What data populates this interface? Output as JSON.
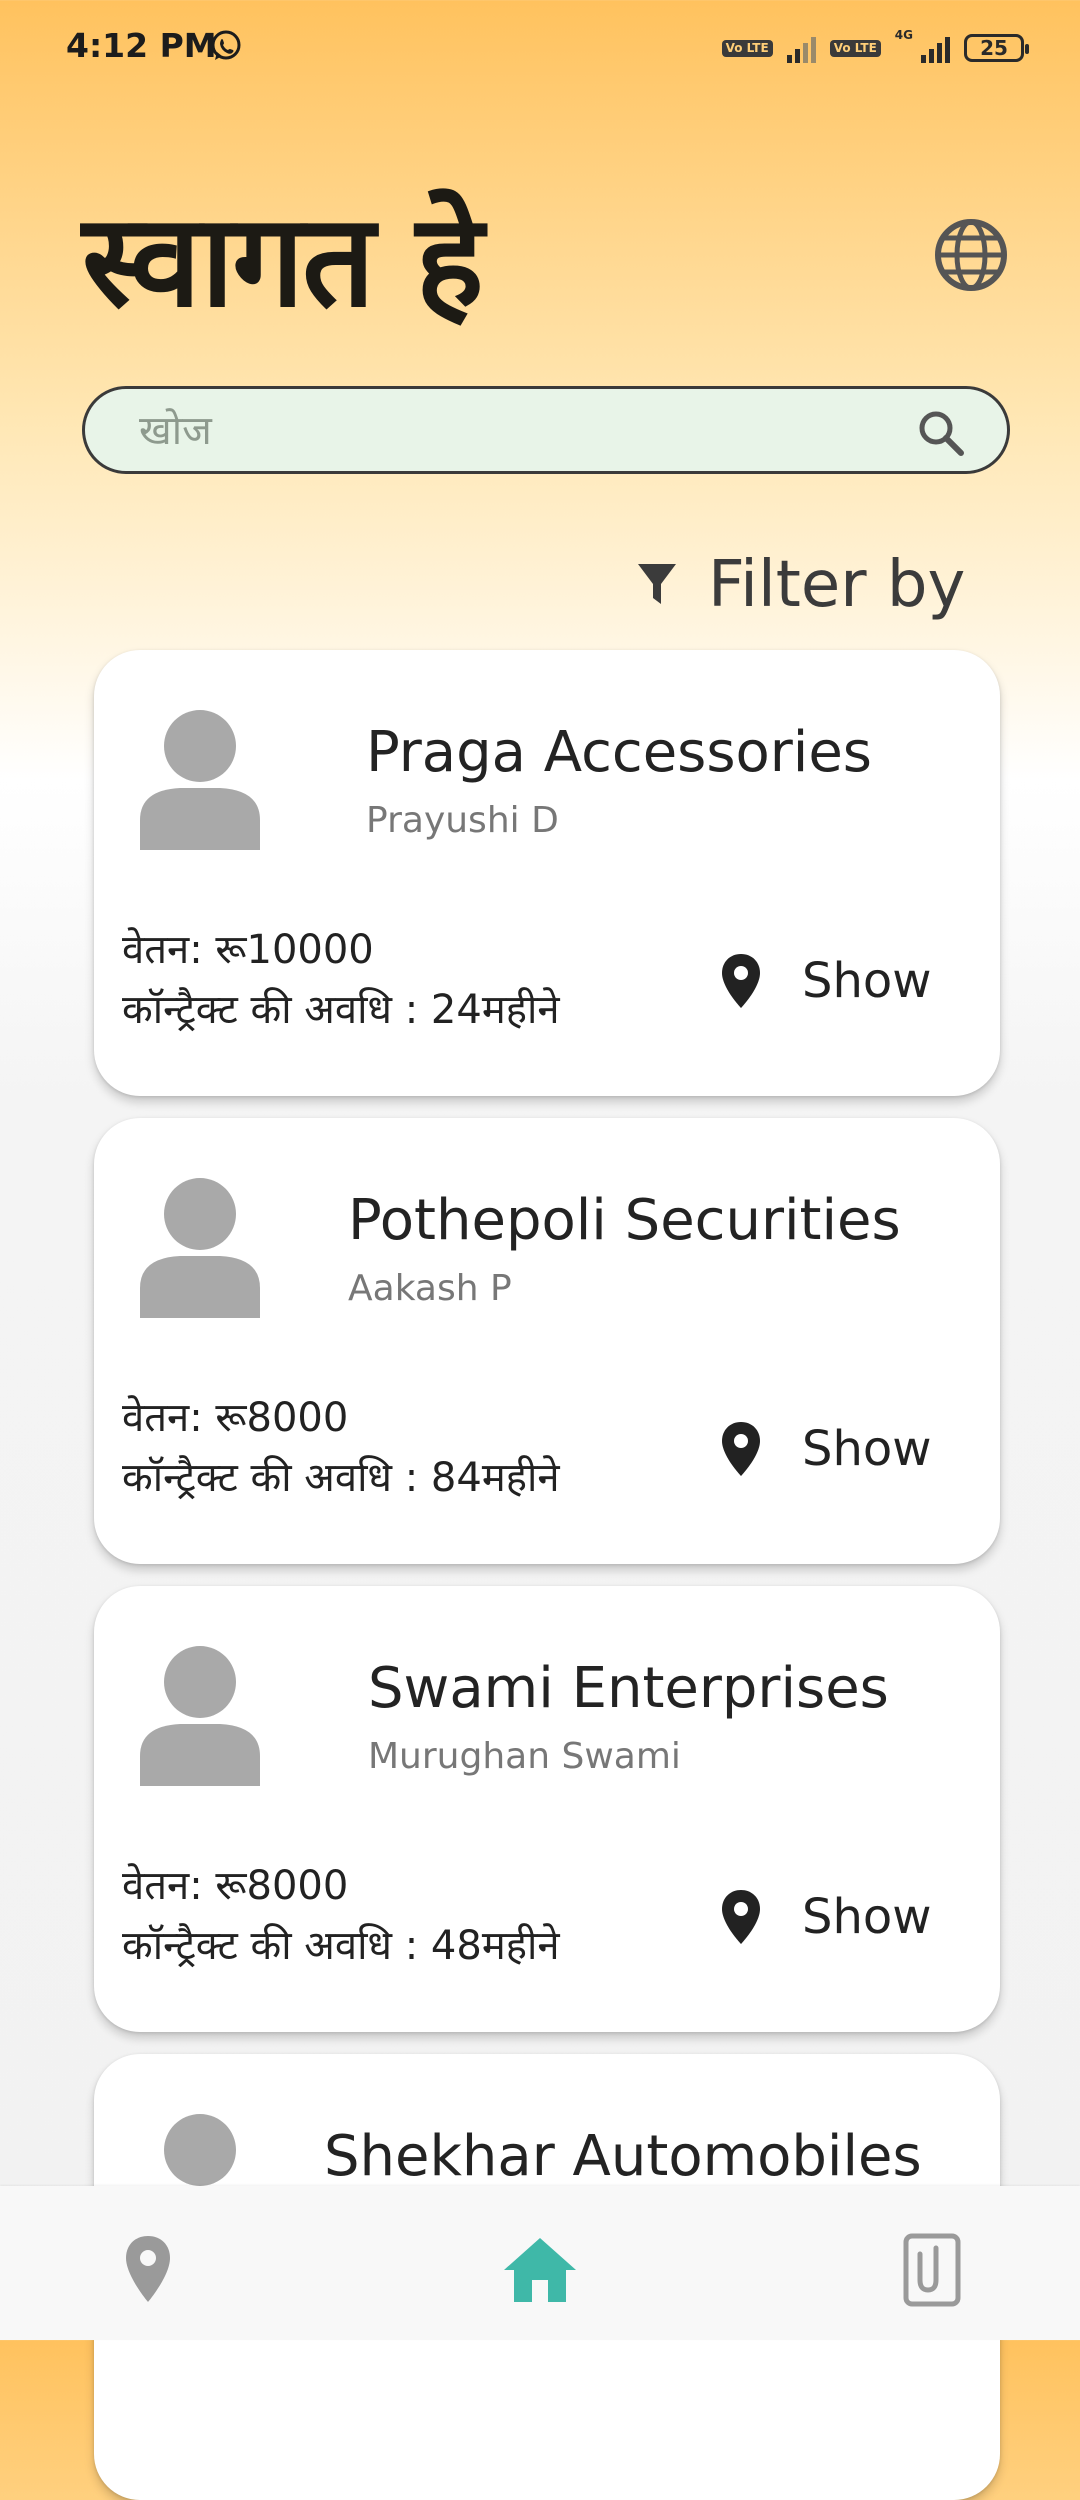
{
  "status_bar": {
    "time": "4:12 PM",
    "volte_label": "Vo LTE",
    "network": "4G",
    "battery": "25"
  },
  "header": {
    "welcome": "स्वागत हे",
    "language_icon": "globe-icon"
  },
  "search": {
    "placeholder": "खोज",
    "icon": "search-icon"
  },
  "filter": {
    "label": "Filter by",
    "icon": "filter-icon"
  },
  "jobs": [
    {
      "company": "Praga Accessories",
      "contact": "Prayushi D",
      "salary": "वेतन: रू10000",
      "duration": "कॉन्ट्रैक्ट की अवधि : 24महीने",
      "location_label": "Show"
    },
    {
      "company": "Pothepoli Securities",
      "contact": "Aakash P",
      "salary": "वेतन: रू8000",
      "duration": "कॉन्ट्रैक्ट की अवधि : 84महीने",
      "location_label": "Show"
    },
    {
      "company": "Swami Enterprises",
      "contact": "Murughan Swami",
      "salary": "वेतन: रू8000",
      "duration": "कॉन्ट्रैक्ट की अवधि : 48महीने",
      "location_label": "Show"
    },
    {
      "company": "Shekhar Automobiles"
    }
  ],
  "bottom_nav": {
    "items": [
      "location-icon",
      "home-icon",
      "document-icon"
    ],
    "active": "home-icon",
    "active_color": "#3FB8A8",
    "inactive_color": "#9A9A9A"
  },
  "colors": {
    "header_gradient_top": "#FFC25E",
    "search_background": "#E8F4E8"
  }
}
